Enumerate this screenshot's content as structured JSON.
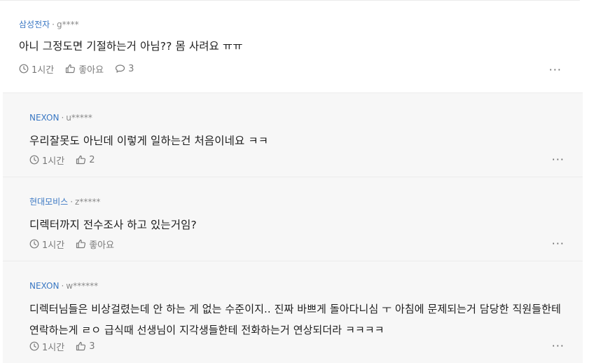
{
  "comments": [
    {
      "company": "삼성전자",
      "user": "g****",
      "text": "아니 그정도면 기절하는거 아님?? 몸 사려요 ㅠㅠ",
      "time": "1시간",
      "like": "좋아요",
      "reply_count": "3",
      "more": "···"
    },
    {
      "company": "NEXON",
      "user": "u*****",
      "text": "우리잘못도 아닌데 이렇게 일하는건 처음이네요 ㅋㅋ",
      "time": "1시간",
      "like": "2",
      "more": "···"
    },
    {
      "company": "현대모비스",
      "user": "z*****",
      "text": "디렉터까지 전수조사 하고 있는거임?",
      "time": "1시간",
      "like": "좋아요",
      "more": "···"
    },
    {
      "company": "NEXON",
      "user": "w******",
      "text": "디렉터님들은 비상걸렸는데 안 하는 게 없는 수준이지.. 진짜 바쁘게 돌아다니심 ㅜ 아침에 문제되는거 담당한 직원들한테 연락하는게 ㄹㅇ 급식때 선생님이 지각생들한테 전화하는거 연상되더라 ㅋㅋㅋㅋ",
      "time": "1시간",
      "like": "3",
      "more": "···"
    }
  ],
  "icons": {
    "time": "clock-icon",
    "like": "thumbs-up-icon",
    "reply": "speech-bubble-icon",
    "more": "more-icon"
  },
  "colors": {
    "company": "#3b78c3",
    "reply_bg": "#f7f7f7",
    "meta": "#8a8a8a"
  }
}
